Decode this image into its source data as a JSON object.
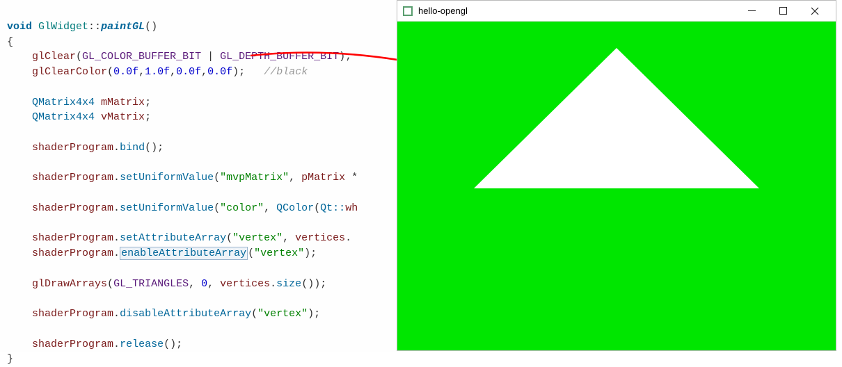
{
  "code": {
    "ret": "void",
    "cls": "GlWidget",
    "scope": "::",
    "fn": "paintGL",
    "parens": "()",
    "lbrace": "{",
    "glClear": "glClear",
    "glClear_args_open": "(",
    "GL_COLOR_BUFFER_BIT": "GL_COLOR_BUFFER_BIT",
    "pipe": " | ",
    "GL_DEPTH_BUFFER_BIT": "GL_DEPTH_BUFFER_BIT",
    "close_semi": ");",
    "glClearColor": "glClearColor",
    "cc_open": "(",
    "cc_a0": "0.0f",
    "comma": ",",
    "cc_a1": "1.0f",
    "cc_a2": "0.0f",
    "cc_a3": "0.0f",
    "cc_close": ");",
    "comment_black": "//black",
    "QMatrix4x4": "QMatrix4x4",
    "mMatrix": "mMatrix",
    "vMatrix": "vMatrix",
    "semi": ";",
    "shaderProgram": "shaderProgram",
    "dot": ".",
    "bind": "bind",
    "empty_call": "();",
    "setUniformValue": "setUniformValue",
    "suv_open": "(",
    "str_mvpMatrix": "\"mvpMatrix\"",
    "comma_sp": ", ",
    "pMatrix": "pMatrix",
    "mul_trail": " *",
    "str_color": "\"color\"",
    "QColor": "QColor",
    "Qt_scope": "Qt::",
    "wh": "wh",
    "setAttributeArray": "setAttributeArray",
    "str_vertex": "\"vertex\"",
    "vertices": "vertices",
    "dot_trail": ".",
    "enableAttributeArray": "enableAttributeArray",
    "eaa_close": ");",
    "glDrawArrays": "glDrawArrays",
    "GL_TRIANGLES": "GL_TRIANGLES",
    "zero": "0",
    "size": "size",
    "size_call": "());",
    "disableAttributeArray": "disableAttributeArray",
    "release": "release",
    "rbrace": "}"
  },
  "window": {
    "title": "hello-opengl"
  },
  "colors": {
    "canvas_bg": "#00e600",
    "triangle": "#ffffff",
    "arrow": "#ff0000"
  }
}
